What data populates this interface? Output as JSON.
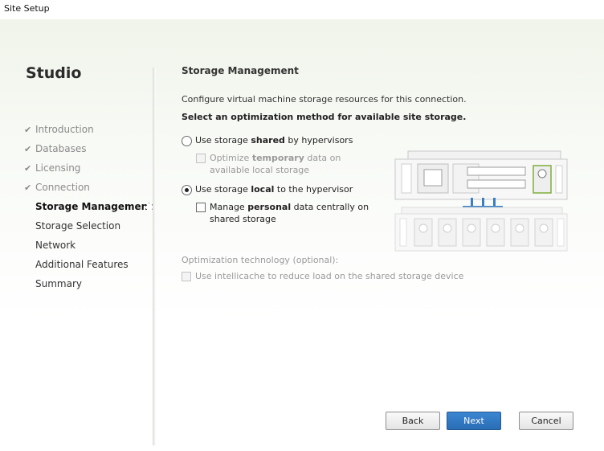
{
  "window": {
    "title": "Site Setup"
  },
  "sidebar": {
    "app_title": "Studio",
    "steps": [
      {
        "label": "Introduction",
        "state": "done"
      },
      {
        "label": "Databases",
        "state": "done"
      },
      {
        "label": "Licensing",
        "state": "done"
      },
      {
        "label": "Connection",
        "state": "done"
      },
      {
        "label": "Storage Management",
        "state": "current"
      },
      {
        "label": "Storage Selection",
        "state": "pending"
      },
      {
        "label": "Network",
        "state": "pending"
      },
      {
        "label": "Additional Features",
        "state": "pending"
      },
      {
        "label": "Summary",
        "state": "pending"
      }
    ],
    "done_icon": "checkmark-icon"
  },
  "main": {
    "heading": "Storage Management",
    "description": "Configure virtual machine storage resources for this connection.",
    "instruction": "Select an optimization method for available site storage.",
    "option_shared": {
      "pre": "Use storage ",
      "bold": "shared",
      "post": " by hypervisors",
      "selected": false,
      "sub_option": {
        "pre": "Optimize ",
        "bold": "temporary",
        "post": " data on available local storage",
        "checked": false,
        "enabled": false
      }
    },
    "option_local": {
      "pre": "Use storage ",
      "bold": "local",
      "post": " to the hypervisor",
      "selected": true,
      "sub_option": {
        "pre": "Manage ",
        "bold": "personal",
        "post": " data centrally on shared storage",
        "checked": false,
        "enabled": true
      }
    },
    "optimization": {
      "label": "Optimization technology (optional):",
      "intellicache_label": "Use intellicache to reduce load on the shared storage device",
      "checked": false,
      "enabled": false
    },
    "illustration_icon": "server-storage-illustration-icon"
  },
  "footer": {
    "back_label": "Back",
    "next_label": "Next",
    "cancel_label": "Cancel"
  },
  "colors": {
    "primary_button": "#2a6db5",
    "disabled_text": "#9a9a9a",
    "connector_blue": "#3a7fc4"
  }
}
